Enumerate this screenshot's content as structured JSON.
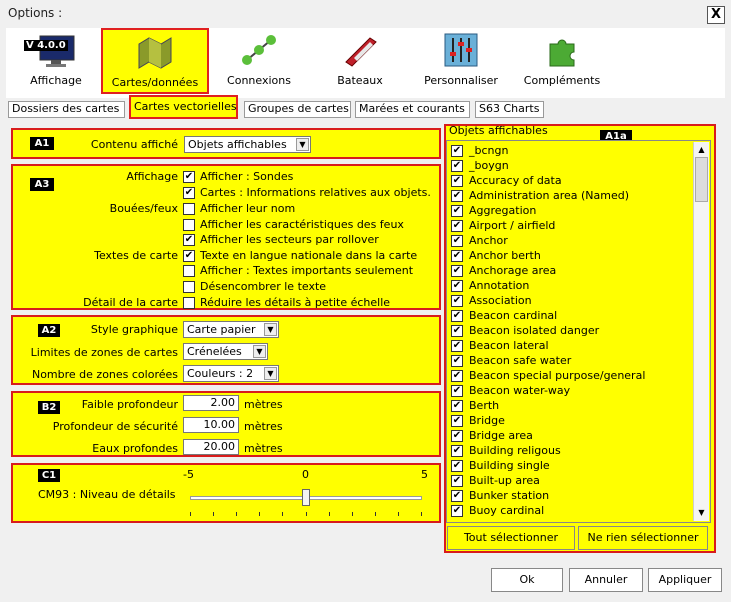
{
  "window": {
    "title": "Options :",
    "close_glyph": "X"
  },
  "toolbar": {
    "items": [
      {
        "label": "Affichage",
        "badge": "V 4.0.0"
      },
      {
        "label": "Cartes/données"
      },
      {
        "label": "Connexions"
      },
      {
        "label": "Bateaux"
      },
      {
        "label": "Personnaliser"
      },
      {
        "label": "Compléments"
      }
    ]
  },
  "tabs": [
    "Dossiers des cartes",
    "Cartes vectorielles",
    "Groupes de cartes",
    "Marées et courants",
    "S63 Charts"
  ],
  "a1": {
    "badge": "A1",
    "label": "Contenu affiché",
    "value": "Objets affichables"
  },
  "a3": {
    "badge": "A3",
    "groups": {
      "affichage": "Affichage",
      "bouees": "Bouées/feux",
      "textes": "Textes de carte",
      "detail": "Détail de la carte"
    },
    "checks": [
      {
        "label": "Afficher : Sondes",
        "checked": true
      },
      {
        "label": "Cartes : Informations relatives aux objets.",
        "checked": true
      },
      {
        "label": "Afficher leur nom",
        "checked": false
      },
      {
        "label": "Afficher les caractéristiques des feux",
        "checked": false
      },
      {
        "label": "Afficher les secteurs par rollover",
        "checked": true
      },
      {
        "label": "Texte en langue nationale dans la carte",
        "checked": true
      },
      {
        "label": "Afficher : Textes importants seulement",
        "checked": false
      },
      {
        "label": "Désencombrer le texte",
        "checked": false
      },
      {
        "label": "Réduire les détails à petite échelle",
        "checked": false
      }
    ]
  },
  "a2": {
    "badge": "A2",
    "style_label": "Style graphique",
    "style_value": "Carte papier",
    "limits_label": "Limites de zones de cartes",
    "limits_value": "Crénelées",
    "zones_label": "Nombre de zones colorées",
    "zones_value": "Couleurs : 2"
  },
  "b2": {
    "badge": "B2",
    "shallow_label": "Faible profondeur",
    "shallow_value": "2.00",
    "safety_label": "Profondeur de sécurité",
    "safety_value": "10.00",
    "deep_label": "Eaux profondes",
    "deep_value": "20.00",
    "unit": "mètres"
  },
  "c1": {
    "badge": "C1",
    "label": "CM93 : Niveau de détails",
    "min": "-5",
    "mid": "0",
    "max": "5",
    "value": 0
  },
  "objects": {
    "title": "Objets affichables",
    "badge": "A1a",
    "items": [
      "_bcngn",
      "_boygn",
      "Accuracy of data",
      "Administration area (Named)",
      "Aggregation",
      "Airport / airfield",
      "Anchor",
      "Anchor berth",
      "Anchorage area",
      "Annotation",
      "Association",
      "Beacon cardinal",
      "Beacon isolated danger",
      "Beacon lateral",
      "Beacon safe water",
      "Beacon special purpose/general",
      "Beacon water-way",
      "Berth",
      "Bridge",
      "Bridge area",
      "Building religous",
      "Building single",
      "Built-up area",
      "Bunker station",
      "Buoy cardinal"
    ],
    "select_all": "Tout sélectionner",
    "select_none": "Ne rien sélectionner"
  },
  "footer": {
    "ok": "Ok",
    "cancel": "Annuler",
    "apply": "Appliquer"
  },
  "colors": {
    "highlight": "#ffff00",
    "border": "#d81c1c"
  }
}
